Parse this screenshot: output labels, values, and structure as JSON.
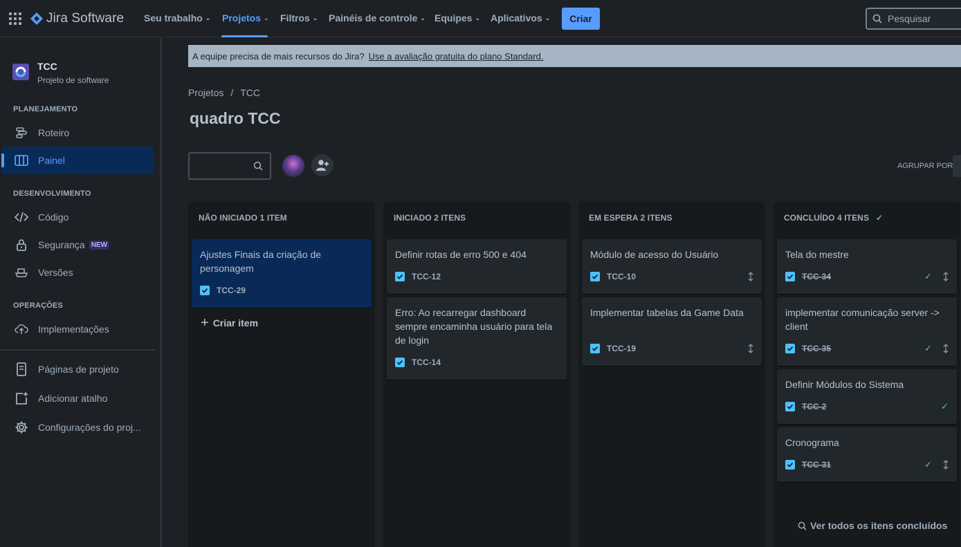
{
  "app": {
    "name": "Jira Software"
  },
  "topnav": {
    "items": [
      {
        "label": "Seu trabalho"
      },
      {
        "label": "Projetos"
      },
      {
        "label": "Filtros"
      },
      {
        "label": "Painéis de controle"
      },
      {
        "label": "Equipes"
      },
      {
        "label": "Aplicativos"
      }
    ],
    "active": "Projetos",
    "create_label": "Criar",
    "search_placeholder": "Pesquisar"
  },
  "sidebar": {
    "project_name": "TCC",
    "project_type": "Projeto de software",
    "sections": {
      "planning": "PLANEJAMENTO",
      "development": "DESENVOLVIMENTO",
      "operations": "OPERAÇÕES"
    },
    "items": {
      "roadmap": "Roteiro",
      "board": "Painel",
      "code": "Código",
      "security": "Segurança",
      "security_badge": "NEW",
      "releases": "Versões",
      "deployments": "Implementações",
      "project_pages": "Páginas de projeto",
      "add_shortcut": "Adicionar atalho",
      "settings": "Configurações do proj..."
    }
  },
  "banner": {
    "text": "A equipe precisa de mais recursos do Jira?",
    "link": "Use a avaliação gratuita do plano Standard."
  },
  "breadcrumb": {
    "root": "Projetos",
    "separator": "/",
    "project": "TCC"
  },
  "board": {
    "title": "quadro TCC",
    "group_by_label": "AGRUPAR POR",
    "create_item_label": "Criar item",
    "view_all_done_label": "Ver todos os itens concluídos",
    "columns": [
      {
        "header": "NÃO INICIADO 1 ITEM",
        "cards": [
          {
            "title": "Ajustes Finais da criação de personagem",
            "key": "TCC-29"
          }
        ]
      },
      {
        "header": "INICIADO 2 ITENS",
        "cards": [
          {
            "title": "Definir rotas de erro 500 e 404",
            "key": "TCC-12"
          },
          {
            "title": "Erro: Ao recarregar dashboard sempre encaminha usuário para tela de login",
            "key": "TCC-14"
          }
        ]
      },
      {
        "header": "EM ESPERA 2 ITENS",
        "cards": [
          {
            "title": "Módulo de acesso do Usuário",
            "key": "TCC-10"
          },
          {
            "title": "Implementar tabelas da Game Data",
            "key": "TCC-19"
          }
        ]
      },
      {
        "header": "CONCLUÍDO 4 ITENS",
        "cards": [
          {
            "title": "Tela do mestre",
            "key": "TCC-34"
          },
          {
            "title": "implementar comunicação server -> client",
            "key": "TCC-35"
          },
          {
            "title": "Definir Módulos do Sistema",
            "key": "TCC-2"
          },
          {
            "title": "Cronograma",
            "key": "TCC-31"
          }
        ]
      }
    ]
  },
  "colors": {
    "background": "#1d2125",
    "accent": "#579dff",
    "column_bg": "#161a1d",
    "card_bg": "#22272b",
    "selected_card": "#092957",
    "done_green": "#4bce97",
    "checkbox": "#4cc2ff",
    "banner_bg": "#a6b5c4"
  }
}
